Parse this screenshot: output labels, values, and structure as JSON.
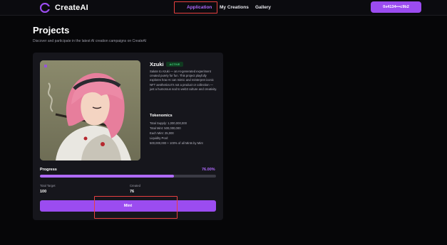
{
  "header": {
    "brand": "CreateAI",
    "nav": [
      {
        "label": "Application",
        "active": true
      },
      {
        "label": "My Creations",
        "active": false
      },
      {
        "label": "Gallery",
        "active": false
      }
    ],
    "wallet": "0x4134•••c9b2"
  },
  "page": {
    "title": "Projects",
    "subtitle": "Discover and participate in the latest AI creation campaigns on CreateAI"
  },
  "project": {
    "name": "Xzuki",
    "status": "ACTIVE",
    "description": "Salute to Azuki — an AI-generated experiment created purely for fun. This project playfully explores how AI can mimic and reinterpret iconic NFT aesthetics.It's not a product or collection — just a humorous nod to web3 culture and creativity.",
    "tokenomics_title": "Tokenomics",
    "tokenomics": [
      "Total Supply: 1,000,000,000",
      "Total Mint: 500,000,000",
      "Each Mint: 25,000",
      "Liquidity Pool:",
      "500,000,000 + 100% of all Mints by Mint"
    ],
    "progress_label": "Progress",
    "progress_value": "76.00%",
    "progress_fraction": 0.76,
    "total_target_label": "Total Target",
    "total_target": "100",
    "created_label": "Created",
    "created": "76",
    "mint_label": "Mint"
  },
  "colors": {
    "accent": "#9b4cf0",
    "accent_text": "#b06bff",
    "status_green": "#3fd27a",
    "annotation_red": "#e8403f"
  }
}
